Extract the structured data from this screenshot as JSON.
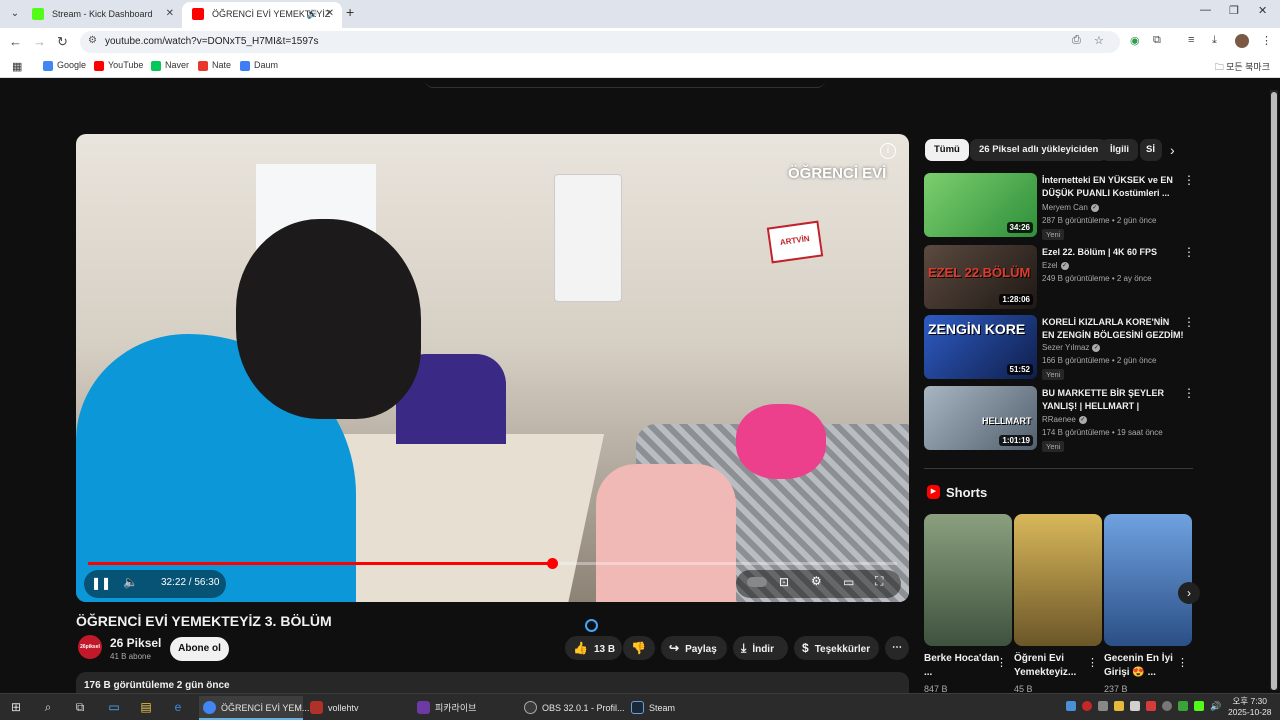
{
  "browser": {
    "tabs": [
      {
        "label": "Stream - Kick Dashboard",
        "favicon_color": "#53fc18",
        "active": false
      },
      {
        "label": "ÖĞRENCİ EVİ YEMEKTEYİZ",
        "favicon_color": "#ff0000",
        "active": true
      }
    ],
    "url": "youtube.com/watch?v=DONxT5_H7MI&t=1597s",
    "bookmarks": [
      {
        "label": "Google",
        "color": "#4285f4"
      },
      {
        "label": "YouTube",
        "color": "#ff0000"
      },
      {
        "label": "Naver",
        "color": "#03c75a"
      },
      {
        "label": "Nate",
        "color": "#e8372c"
      },
      {
        "label": "Daum",
        "color": "#3f7df4"
      }
    ],
    "all_bookmarks_label": "모든 북마크"
  },
  "player": {
    "watermark": "ÖĞRENCİ EVİ",
    "sign_text": "ARTVİN",
    "current_time": "32:22 / 56:30",
    "progress_fraction": 0.574,
    "accent": "#ff0000"
  },
  "video": {
    "title": "ÖĞRENCİ EVİ YEMEKTEYİZ 3. BÖLÜM",
    "channel_name": "26 Piksel",
    "channel_avatar_text": "26piksel",
    "subscribers": "41 B abone",
    "subscribe_label": "Abone ol",
    "likes": "13 B",
    "share_label": "Paylaş",
    "download_label": "İndir",
    "thanks_label": "Teşekkürler",
    "views_date": "176 B görüntüleme  2 gün önce"
  },
  "chips": [
    "Tümü",
    "26 Piksel adlı yükleyiciden",
    "İlgili",
    "Sİ"
  ],
  "recommendations": [
    {
      "title": "İnternetteki EN YÜKSEK  ve EN DÜŞÜK PUANLI Kostümleri ...",
      "channel": "Meryem Can",
      "meta": "287 B görüntüleme • 2 gün önce",
      "badge": "Yeni",
      "duration": "34:26",
      "thumb_text": "",
      "thumb_color": "#3fae47"
    },
    {
      "title": "Ezel 22. Bölüm | 4K 60 FPS",
      "channel": "Ezel",
      "meta": "249 B görüntüleme • 2 ay önce",
      "badge": "",
      "duration": "1:28:06",
      "thumb_text": "EZEL 22.BÖLÜM",
      "thumb_color": "#2a2320"
    },
    {
      "title": "KORELİ KIZLARLA KORE'NİN EN ZENGİN BÖLGESİNİ GEZDİM!",
      "channel": "Sezer Yılmaz",
      "meta": "166 B görüntüleme • 2 gün önce",
      "badge": "Yeni",
      "duration": "51:52",
      "thumb_text": "ZENGİN KORE",
      "thumb_color": "#1b3f8a"
    },
    {
      "title": "BU MARKETTE BİR ŞEYLER YANLIŞ! | HELLMART |",
      "channel": "RRaenee",
      "meta": "174 B görüntüleme • 19 saat önce",
      "badge": "Yeni",
      "duration": "1:01:19",
      "thumb_text": "HELLMART",
      "thumb_color": "#6e7f8e"
    }
  ],
  "shorts": {
    "heading": "Shorts",
    "items": [
      {
        "title": "Berke Hoca'dan ...",
        "views": "847 B",
        "color": "#4d6a4c"
      },
      {
        "title": "Öğreni Evi Yemekteyiz...",
        "views": "45 B",
        "color": "#c8a14b"
      },
      {
        "title": "Gecenin En İyi Girişi 😍 ...",
        "views": "237 B",
        "color": "#3f74b8"
      }
    ]
  },
  "taskbar": {
    "apps": [
      {
        "label": "ÖĞRENCİ EVİ YEM...",
        "color": "#4285f4",
        "active": true
      },
      {
        "label": "vollehtv",
        "color": "#b0302a",
        "active": false
      },
      {
        "label": "피카라이브",
        "color": "#6d3aa3",
        "active": false
      },
      {
        "label": "OBS 32.0.1 - Profil...",
        "color": "#3a3a3a",
        "active": false
      },
      {
        "label": "Steam",
        "color": "#1b2838",
        "active": false
      }
    ],
    "clock_time": "오후 7:30",
    "clock_date": "2025-10-28"
  }
}
